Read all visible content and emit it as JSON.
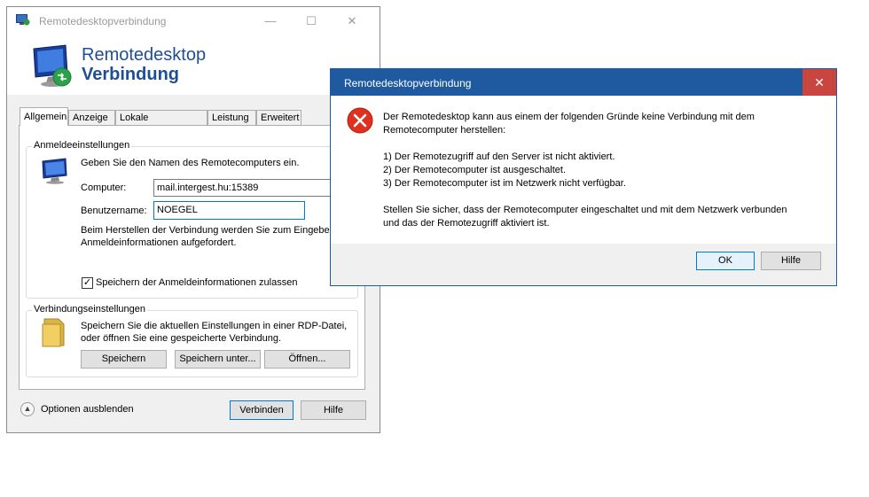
{
  "main_window": {
    "title": "Remotedesktopverbindung",
    "caption_buttons": {
      "minimize": "—",
      "maximize": "☐",
      "close": "✕"
    },
    "banner": {
      "line1": "Remotedesktop",
      "line2": "Verbindung"
    },
    "tabs": [
      "Allgemein",
      "Anzeige",
      "Lokale Ressourcen",
      "Leistung",
      "Erweitert"
    ],
    "login_group": {
      "label": "Anmeldeeinstellungen",
      "instruction": "Geben Sie den Namen des Remotecomputers ein.",
      "computer_label": "Computer:",
      "computer_value": "mail.intergest.hu:15389",
      "username_label": "Benutzername:",
      "username_value": "NOEGEL",
      "info_line1": "Beim Herstellen der Verbindung werden Sie zum Eingeben von",
      "info_line2": "Anmeldeinformationen aufgefordert.",
      "save_checkbox_label": "Speichern der Anmeldeinformationen zulassen",
      "save_checked": true
    },
    "connection_group": {
      "label": "Verbindungseinstellungen",
      "line1": "Speichern Sie die aktuellen Einstellungen in einer RDP-Datei,",
      "line2": "oder öffnen Sie eine gespeicherte Verbindung.",
      "save_button": "Speichern",
      "save_as_button": "Speichern unter...",
      "open_button": "Öffnen..."
    },
    "footer": {
      "hide_options_label": "Optionen ausblenden",
      "connect_button": "Verbinden",
      "help_button": "Hilfe"
    }
  },
  "error_dialog": {
    "title": "Remotedesktopverbindung",
    "close_glyph": "✕",
    "message_line1": "Der Remotedesktop kann aus einem der folgenden Gründe keine Verbindung mit dem",
    "message_line2": "Remotecomputer herstellen:",
    "reason1": "1) Der Remotezugriff auf den Server ist nicht aktiviert.",
    "reason2": "2) Der Remotecomputer ist ausgeschaltet.",
    "reason3": "3) Der Remotecomputer ist im Netzwerk nicht verfügbar.",
    "advice_line1": "Stellen Sie sicher, dass der Remotecomputer eingeschaltet und mit dem Netzwerk verbunden",
    "advice_line2": "und das der Remotezugriff aktiviert ist.",
    "ok_button": "OK",
    "help_button": "Hilfe"
  },
  "colors": {
    "accent_blue": "#1f5aa0",
    "close_red": "#c8463f",
    "banner_text": "#1f4e98",
    "error_icon": "#e0301e"
  }
}
